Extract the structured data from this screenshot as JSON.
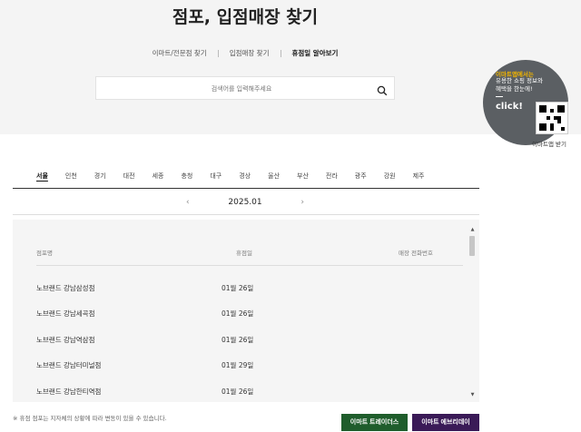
{
  "page": {
    "title": "점포, 입점매장 찾기",
    "tabs": [
      {
        "label": "이마트/전문점 찾기",
        "active": false
      },
      {
        "label": "입점매장 찾기",
        "active": false
      },
      {
        "label": "휴점일 알아보기",
        "active": true
      }
    ],
    "search": {
      "placeholder": "검색어를 입력해주세요",
      "icon": "search-icon"
    }
  },
  "promo": {
    "line1": "이마트앱에서는",
    "line2": "유용한 쇼핑 정보와 혜택을 한눈에!",
    "dash": "-",
    "click": "click!",
    "qr_label": "이마트앱 받기"
  },
  "regions": [
    {
      "label": "서울",
      "active": true
    },
    {
      "label": "인천",
      "active": false
    },
    {
      "label": "경기",
      "active": false
    },
    {
      "label": "대전",
      "active": false
    },
    {
      "label": "세종",
      "active": false
    },
    {
      "label": "충청",
      "active": false
    },
    {
      "label": "대구",
      "active": false
    },
    {
      "label": "경상",
      "active": false
    },
    {
      "label": "울산",
      "active": false
    },
    {
      "label": "부산",
      "active": false
    },
    {
      "label": "전라",
      "active": false
    },
    {
      "label": "광주",
      "active": false
    },
    {
      "label": "강원",
      "active": false
    },
    {
      "label": "제주",
      "active": false
    }
  ],
  "month_nav": {
    "prev": "‹",
    "current": "2025.01",
    "next": "›"
  },
  "table": {
    "headers": {
      "store": "점포명",
      "closed": "휴점일",
      "phone": "매장 전화번호"
    },
    "rows": [
      {
        "store": "노브랜드 강남삼성점",
        "closed": "01월 26일",
        "phone": ""
      },
      {
        "store": "노브랜드 강남세곡점",
        "closed": "01월 26일",
        "phone": ""
      },
      {
        "store": "노브랜드 강남역삼점",
        "closed": "01월 26일",
        "phone": ""
      },
      {
        "store": "노브랜드 강남터미널점",
        "closed": "01월 29일",
        "phone": ""
      },
      {
        "store": "노브랜드 강남한티역점",
        "closed": "01월 26일",
        "phone": ""
      }
    ]
  },
  "footer": {
    "note": "※ 휴점 점포는 지자체의 상황에 따라 변동이 있을 수 있습니다.",
    "btn_green": "이마트 트레이더스",
    "btn_purple": "이마트 에브리데이"
  },
  "colors": {
    "green": "#1f5d2c",
    "purple": "#3a1a57",
    "promo_bg": "#5b5f63",
    "promo_accent": "#f0b400"
  }
}
